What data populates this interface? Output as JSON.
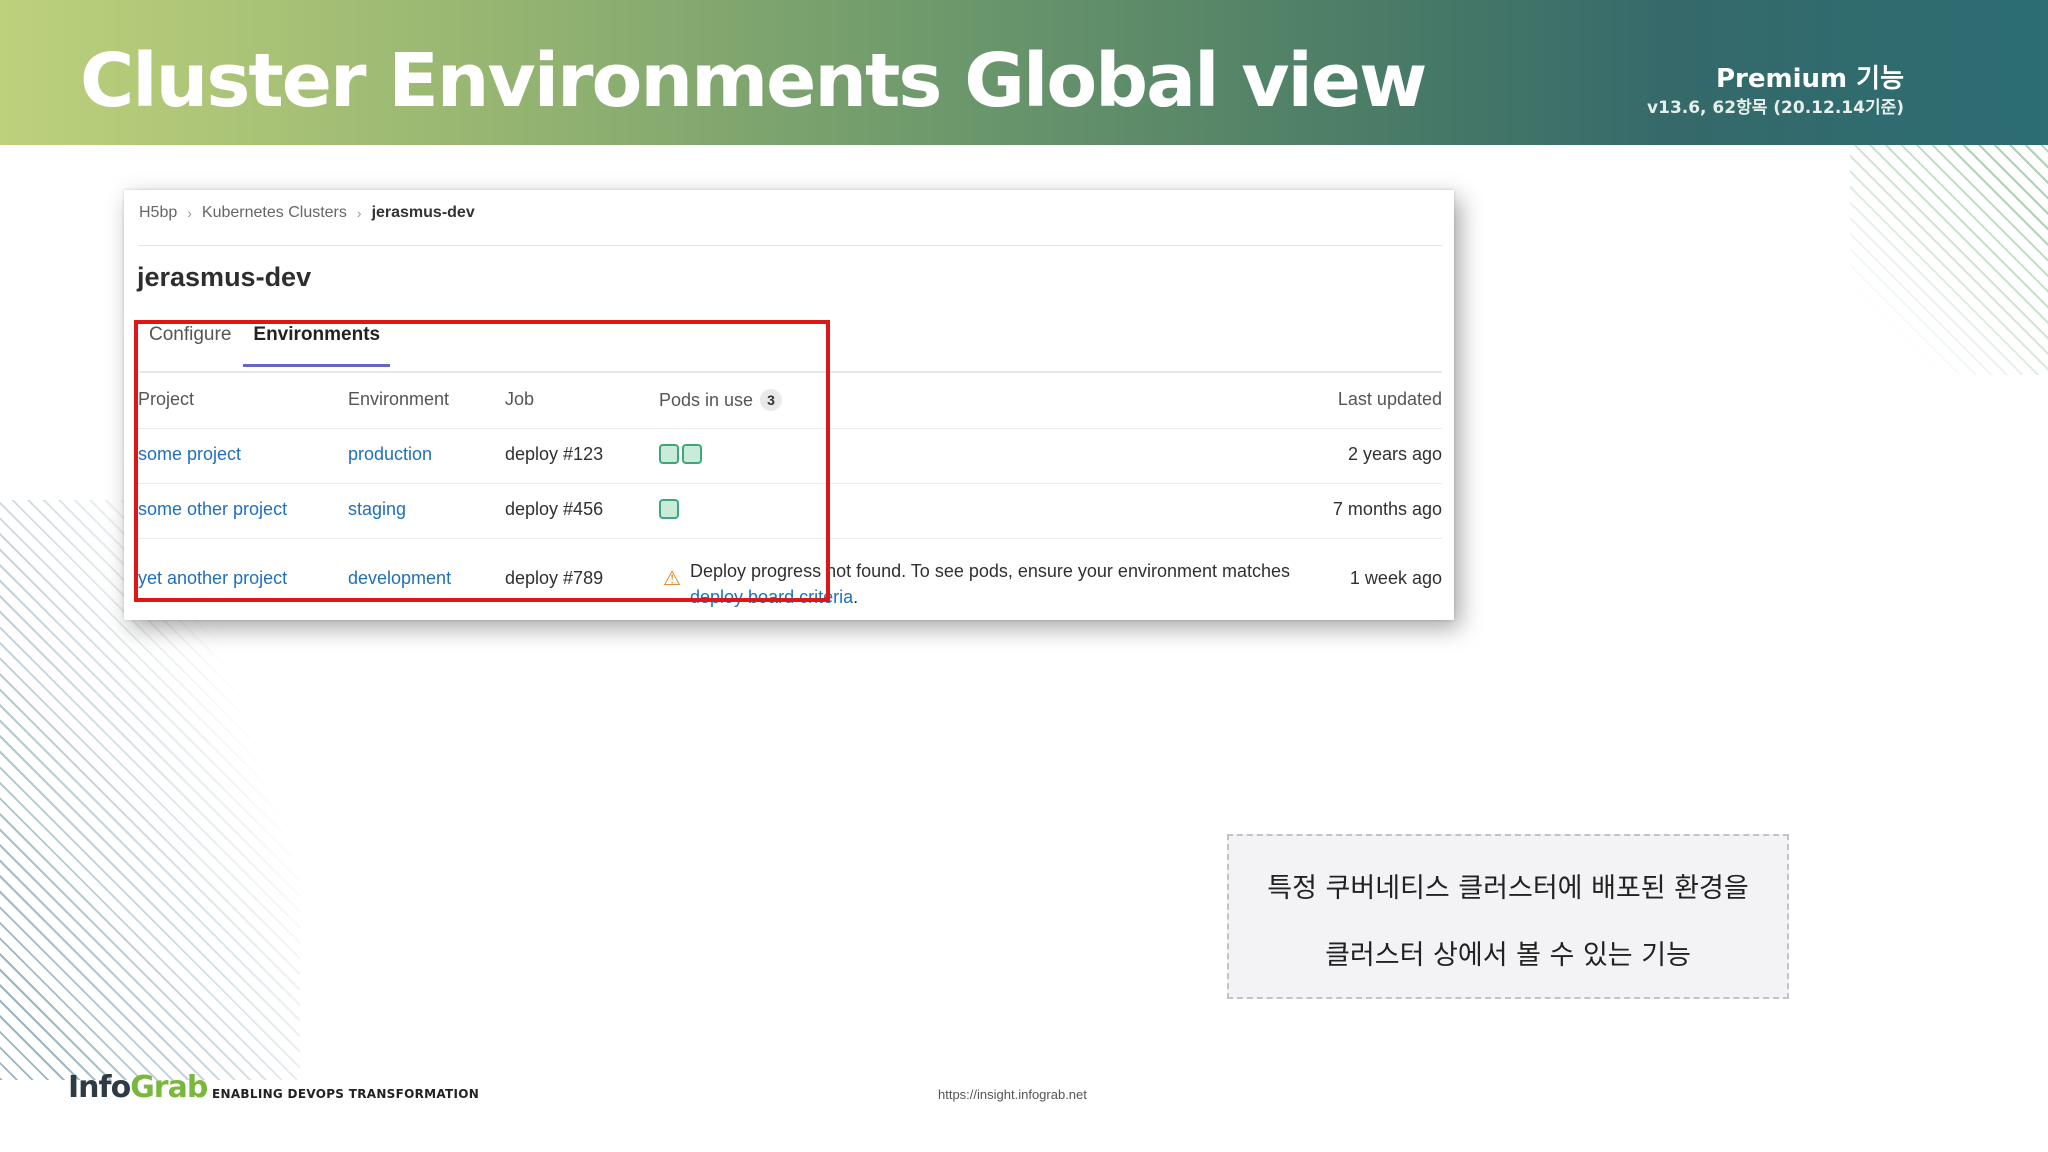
{
  "header": {
    "title": "Cluster Environments Global view",
    "premium_label": "Premium 기능",
    "version_label": "v13.6, 62항목 (20.12.14기준)"
  },
  "screenshot": {
    "breadcrumb": [
      "H5bp",
      "Kubernetes Clusters",
      "jerasmus-dev"
    ],
    "page_title": "jerasmus-dev",
    "tabs": [
      {
        "label": "Configure",
        "active": false
      },
      {
        "label": "Environments",
        "active": true
      }
    ],
    "table": {
      "headers": {
        "project": "Project",
        "environment": "Environment",
        "job": "Job",
        "pods": "Pods in use",
        "pods_count": "3",
        "updated": "Last updated"
      },
      "rows": [
        {
          "project": "some project",
          "environment": "production",
          "job": "deploy #123",
          "pods": 2,
          "updated": "2 years ago"
        },
        {
          "project": "some other project",
          "environment": "staging",
          "job": "deploy #456",
          "pods": 1,
          "updated": "7 months ago"
        },
        {
          "project": "yet another project",
          "environment": "development",
          "job": "deploy #789",
          "pods": 0,
          "warning_text": "Deploy progress not found. To see pods, ensure your environment matches",
          "warning_link": "deploy board criteria",
          "warning_end": ".",
          "updated": "1 week ago"
        }
      ]
    }
  },
  "description": {
    "line1": "특정 쿠버네티스 클러스터에 배포된 환경을",
    "line2": "클러스터 상에서 볼 수 있는 기능"
  },
  "footer": {
    "logo_part1": "Info",
    "logo_part2": "Grab",
    "tagline": "ENABLING DEVOPS TRANSFORMATION",
    "url": "https://insight.infograb.net"
  },
  "colors": {
    "highlight": "#e01515",
    "link": "#1f6fbf",
    "pod_fill": "#c8ecd9",
    "pod_border": "#3fa67a",
    "warning": "#d9821c"
  }
}
